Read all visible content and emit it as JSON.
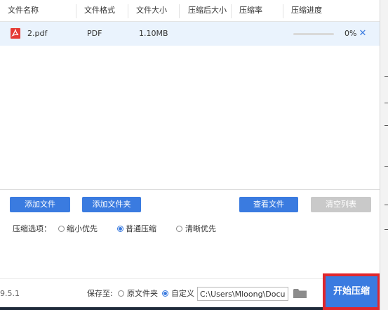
{
  "table": {
    "headers": [
      "文件名称",
      "文件格式",
      "文件大小",
      "压缩后大小",
      "压缩率",
      "压缩进度"
    ],
    "rows": [
      {
        "name": "2.pdf",
        "format": "PDF",
        "size": "1.10MB",
        "compressed_size": "",
        "ratio": "",
        "progress_text": "0%",
        "progress": 0,
        "icon": "pdf-file-icon",
        "remove_glyph": "✕"
      }
    ]
  },
  "buttons": {
    "add_file": "添加文件",
    "add_folder": "添加文件夹",
    "view_file": "查看文件",
    "clear_list": "清空列表",
    "start": "开始压缩"
  },
  "options": {
    "label": "压缩选项：",
    "items": [
      {
        "label": "缩小优先",
        "selected": false
      },
      {
        "label": "普通压缩",
        "selected": true
      },
      {
        "label": "清晰优先",
        "selected": false
      }
    ]
  },
  "footer": {
    "version": "9.5.1",
    "save_label": "保存至:",
    "save_options": [
      {
        "label": "原文件夹",
        "selected": false
      },
      {
        "label": "自定义",
        "selected": true
      }
    ],
    "path": "C:\\Users\\Mloong\\Documents"
  },
  "colors": {
    "accent": "#3a7be0",
    "highlight_border": "#e0272d",
    "row_selected": "#eaf3fd",
    "disabled_button": "#c9c9c9"
  }
}
